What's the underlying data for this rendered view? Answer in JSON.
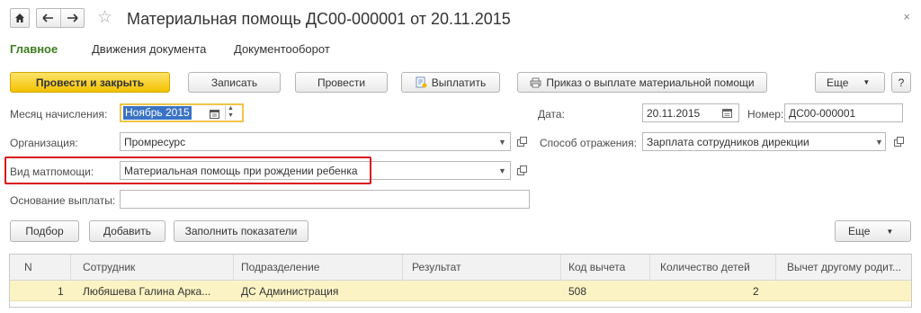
{
  "window": {
    "title": "Материальная помощь ДС00-000001 от 20.11.2015",
    "close_glyph": "×"
  },
  "tabs": [
    "Главное",
    "Движения документа",
    "Документооборот"
  ],
  "toolbar": {
    "post_and_close": "Провести и закрыть",
    "save": "Записать",
    "post": "Провести",
    "pay": "Выплатить",
    "order_print": "Приказ о выплате материальной помощи",
    "more": "Еще",
    "help": "?"
  },
  "form": {
    "month_label": "Месяц начисления:",
    "month_value": "Ноябрь 2015",
    "date_label": "Дата:",
    "date_value": "20.11.2015",
    "number_label": "Номер:",
    "number_value": "ДС00-000001",
    "org_label": "Организация:",
    "org_value": "Промресурс",
    "reflection_label": "Способ отражения:",
    "reflection_value": "Зарплата сотрудников дирекции",
    "aid_type_label": "Вид матпомощи:",
    "aid_type_value": "Материальная помощь при рождении ребенка",
    "basis_label": "Основание выплаты:",
    "basis_value": ""
  },
  "table_toolbar": {
    "select": "Подбор",
    "add": "Добавить",
    "fill": "Заполнить показатели",
    "more": "Еще"
  },
  "table": {
    "columns": [
      "N",
      "Сотрудник",
      "Подразделение",
      "Результат",
      "Код вычета",
      "Количество детей",
      "Вычет другому родит..."
    ],
    "rows": [
      {
        "n": "1",
        "employee": "Любяшева Галина Арка...",
        "department": "ДС Администрация",
        "result": "",
        "deduction_code": "508",
        "children": "2",
        "other_parent": ""
      }
    ]
  },
  "colors": {
    "primary_button": "#f2c200",
    "active_tab": "#3d7d1f",
    "highlight": "#d9141b",
    "selected_row": "#fbf3c4",
    "month_selection": "#3b73c4"
  },
  "icons": [
    "home-icon",
    "back-arrow-icon",
    "forward-arrow-icon",
    "star-icon",
    "close-icon",
    "pay-doc-icon",
    "print-icon",
    "calendar-icon",
    "dropdown-icon",
    "open-icon"
  ]
}
